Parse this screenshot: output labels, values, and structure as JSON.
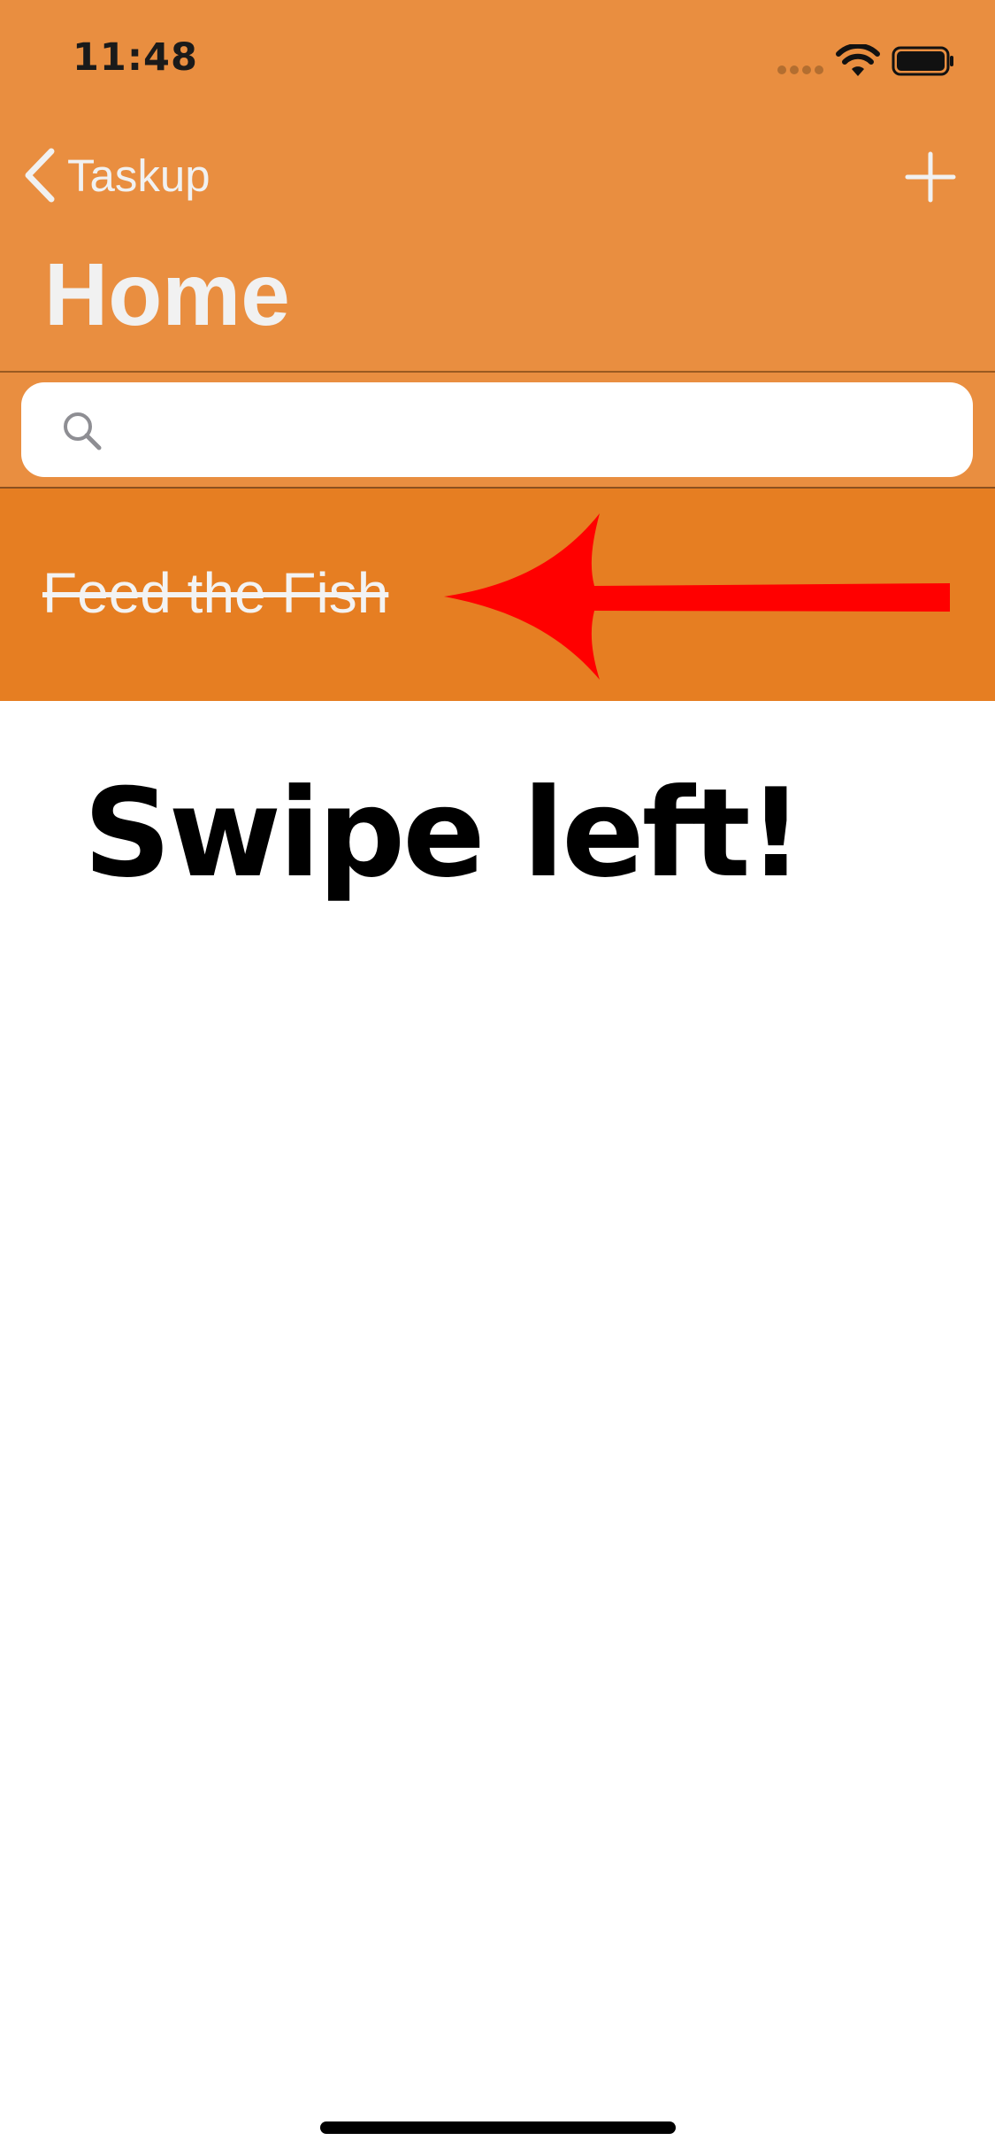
{
  "status_bar": {
    "time": "11:48"
  },
  "nav": {
    "back_label": "Taskup",
    "title": "Home",
    "back_icon": "chevron-left-icon",
    "add_icon": "plus-icon"
  },
  "search": {
    "placeholder": "",
    "value": "",
    "icon": "search-icon"
  },
  "tasks": [
    {
      "title": "Feed the Fish",
      "completed": true
    }
  ],
  "annotation": {
    "hint": "Swipe left!",
    "arrow_icon": "left-arrow-icon",
    "arrow_color": "#FF0000"
  },
  "colors": {
    "header_background": "#E98E40",
    "row_background": "#E67E22",
    "header_text": "#F1F1F1"
  }
}
